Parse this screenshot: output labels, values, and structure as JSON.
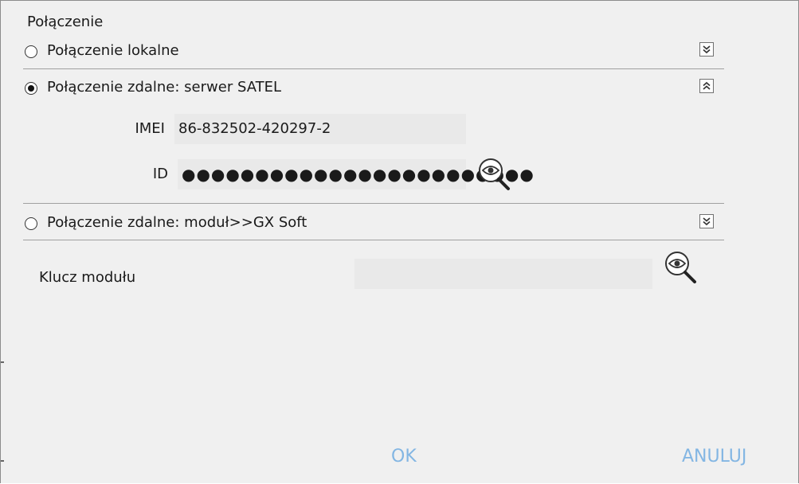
{
  "group": {
    "title": "Połączenie"
  },
  "connections": {
    "local": {
      "label": "Połączenie lokalne",
      "selected": false,
      "toggle_icon": "chevron-double-down-icon"
    },
    "satel": {
      "label": "Połączenie zdalne: serwer SATEL",
      "selected": true,
      "toggle_icon": "chevron-double-up-icon",
      "imei_label": "IMEI",
      "imei_value": "86-832502-420297-2",
      "id_label": "ID",
      "id_value": "●●●●●●●●●●●●●●●●●●●●●●●●"
    },
    "gxsoft": {
      "label": "Połączenie zdalne: moduł>>GX Soft",
      "selected": false,
      "toggle_icon": "chevron-double-down-icon"
    }
  },
  "module_key": {
    "label": "Klucz modułu",
    "value": ""
  },
  "buttons": {
    "ok": "OK",
    "cancel": "ANULUJ"
  },
  "colors": {
    "button_text": "#83b6e3",
    "background": "#f0f0f0",
    "field": "#e9e9e9"
  }
}
